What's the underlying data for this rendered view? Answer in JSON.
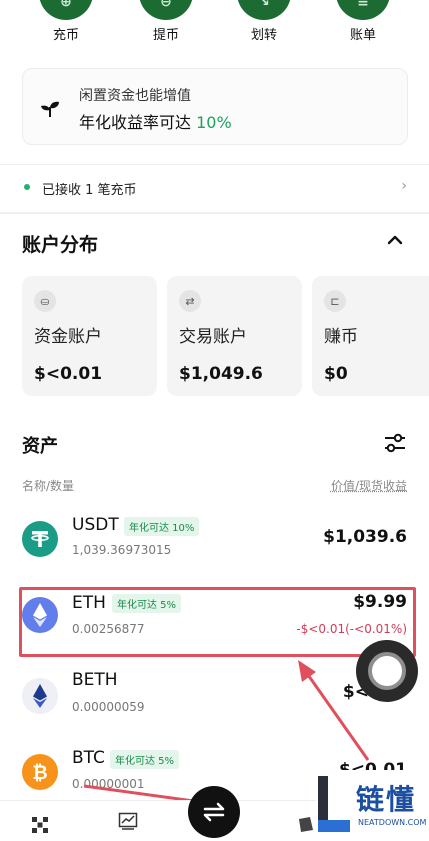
{
  "quick_actions": [
    {
      "label": "充币",
      "icon": "deposit-icon"
    },
    {
      "label": "提币",
      "icon": "withdraw-icon"
    },
    {
      "label": "划转",
      "icon": "transfer-icon"
    },
    {
      "label": "账单",
      "icon": "bill-icon"
    }
  ],
  "promo": {
    "line1": "闲置资金也能增值",
    "line2_prefix": "年化收益率可达",
    "rate": "10%",
    "icon": "sprout-icon"
  },
  "deposit_notice": {
    "text": "已接收 1 笔充币",
    "chevron": "›"
  },
  "distribution": {
    "title": "账户分布",
    "toggle_icon": "chevron-up-icon"
  },
  "accounts": [
    {
      "name": "资金账户",
      "balance": "$<0.01",
      "icon": "⛀"
    },
    {
      "name": "交易账户",
      "balance": "$1,049.6",
      "icon": "⇄"
    },
    {
      "name": "赚币",
      "balance": "$0",
      "icon": "⊏"
    }
  ],
  "assets": {
    "title": "资产",
    "col_left": "名称/数量",
    "col_right": "价值/现货收益",
    "rows": [
      {
        "symbol": "USDT",
        "badge": "年化可达 10%",
        "qty": "1,039.36973015",
        "value": "$1,039.6",
        "pnl": ""
      },
      {
        "symbol": "ETH",
        "badge": "年化可达 5%",
        "qty": "0.00256877",
        "value": "$9.99",
        "pnl": "-$<0.01(-<0.01%)"
      },
      {
        "symbol": "BETH",
        "badge": "",
        "qty": "0.00000059",
        "value": "$<",
        "pnl": ""
      },
      {
        "symbol": "BTC",
        "badge": "年化可达 5%",
        "qty": "0.00000001",
        "value": "$<0.01",
        "pnl": ""
      }
    ]
  },
  "watermark": {
    "cn": "链懂",
    "en": "NEATDOWN.COM"
  },
  "colors": {
    "primary_green": "#1c6b33",
    "accent_green": "#1aa35b",
    "loss_red": "#d23c5a",
    "annotation_red": "#e0505c",
    "usdt": "#1b9c87",
    "eth": "#627eea",
    "btc": "#f7931a",
    "brand_blue": "#1c4fa0"
  }
}
